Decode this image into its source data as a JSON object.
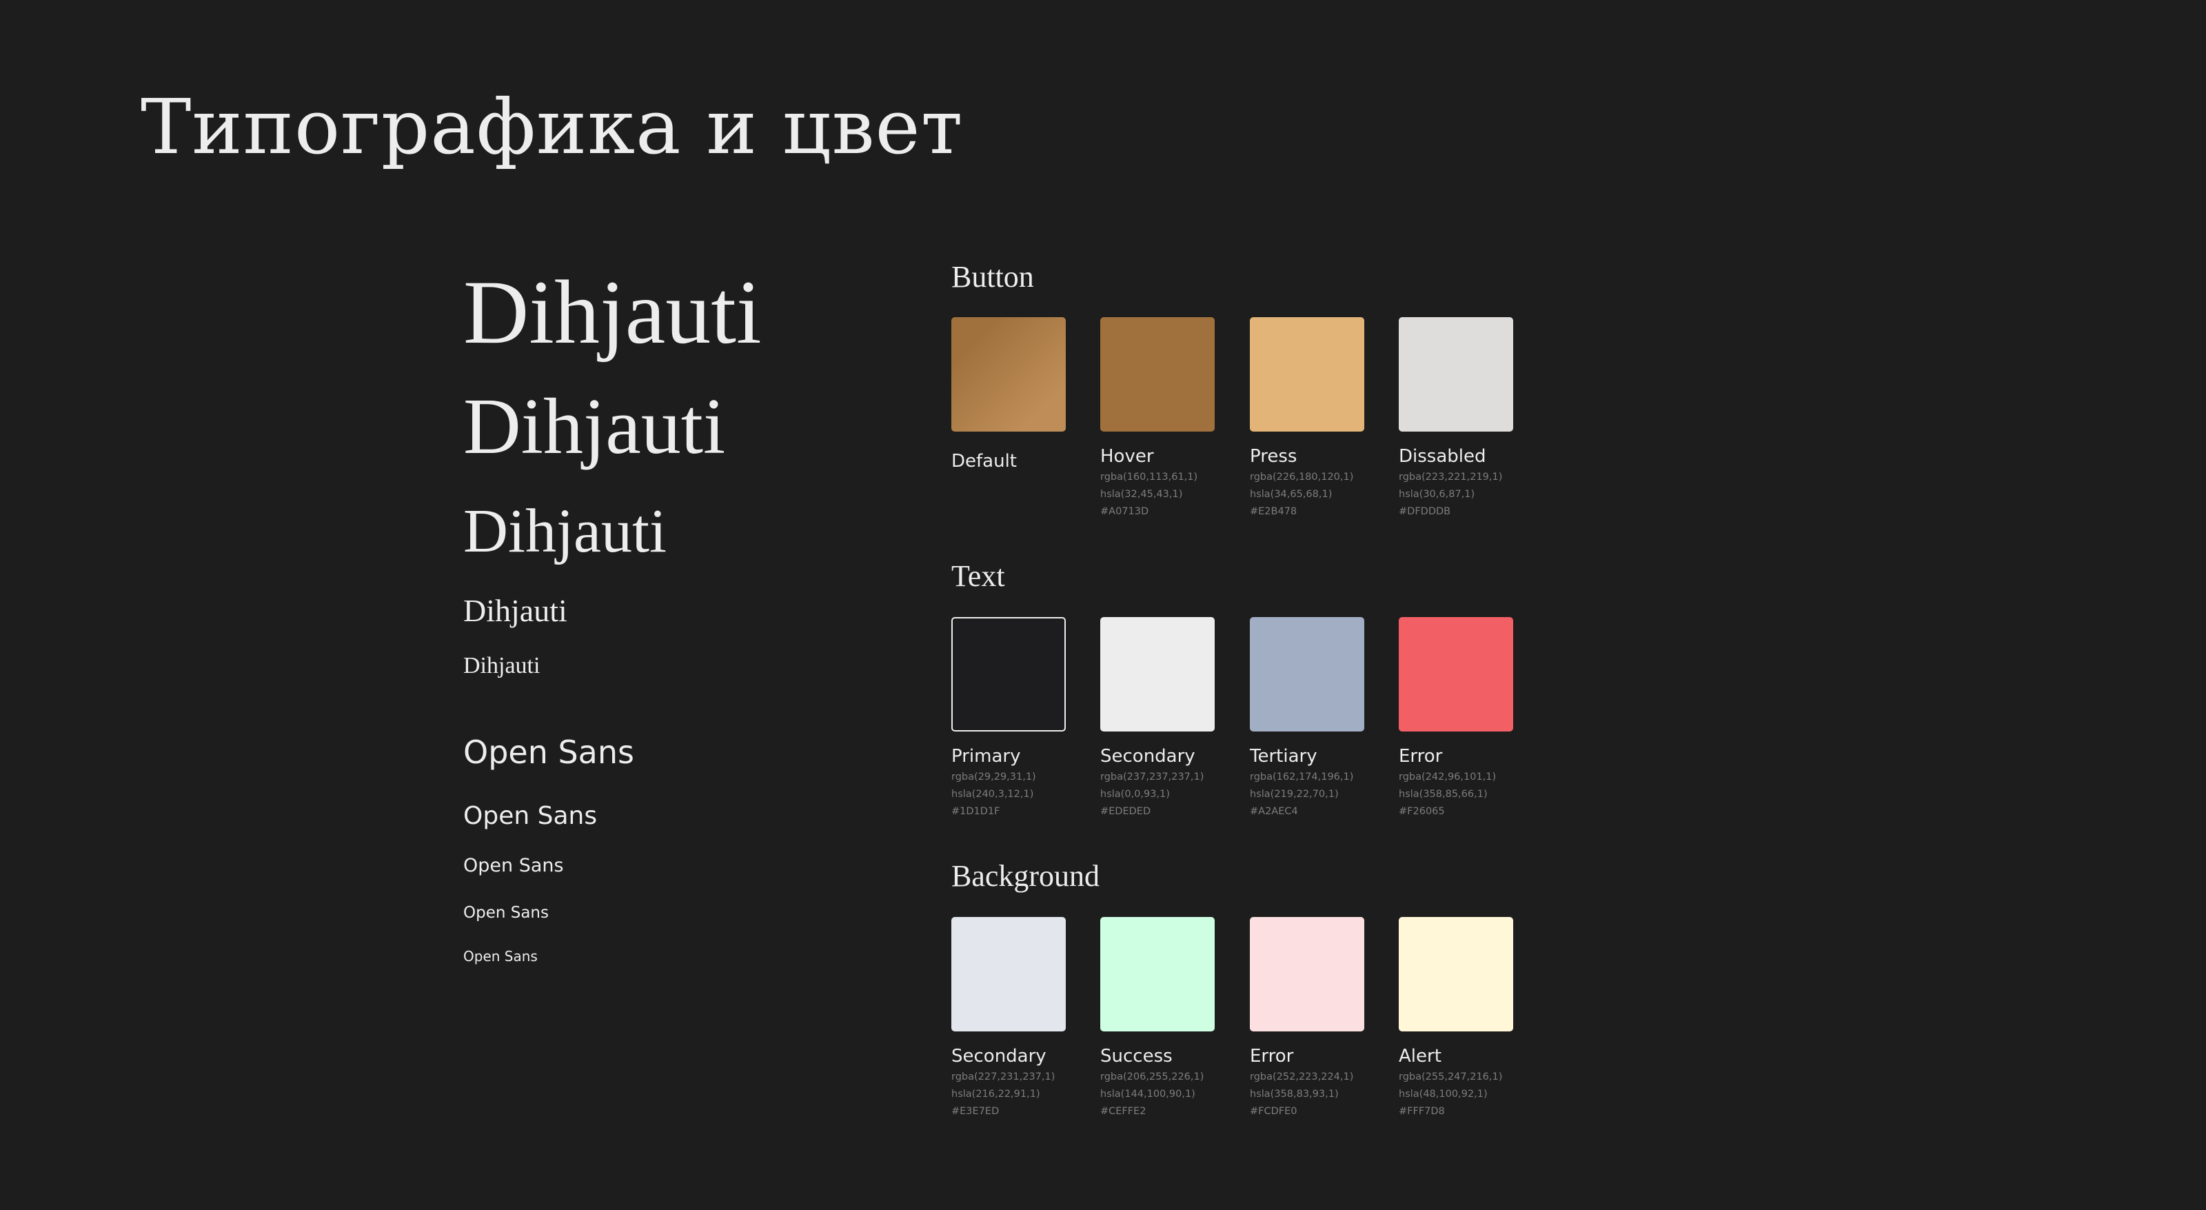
{
  "title": "Типографика и цвет",
  "typography": {
    "serif_samples": [
      "Dihjauti",
      "Dihjauti",
      "Dihjauti",
      "Dihjauti",
      "Dihjauti"
    ],
    "sans_samples": [
      "Open Sans",
      "Open Sans",
      "Open Sans",
      "Open Sans",
      "Open Sans"
    ]
  },
  "sections": {
    "button": {
      "title": "Button",
      "items": [
        {
          "name": "Default",
          "color": "#A0713D",
          "gradient_to": "#BF8E58",
          "rgba": "",
          "hsla": "",
          "hex": ""
        },
        {
          "name": "Hover",
          "color": "#A0713D",
          "rgba": "rgba(160,113,61,1)",
          "hsla": "hsla(32,45,43,1)",
          "hex": "#A0713D"
        },
        {
          "name": "Press",
          "color": "#E2B478",
          "rgba": "rgba(226,180,120,1)",
          "hsla": "hsla(34,65,68,1)",
          "hex": "#E2B478"
        },
        {
          "name": "Dissabled",
          "color": "#DFDDDB",
          "rgba": "rgba(223,221,219,1)",
          "hsla": "hsla(30,6,87,1)",
          "hex": "#DFDDDB"
        }
      ]
    },
    "text": {
      "title": "Text",
      "items": [
        {
          "name": "Primary",
          "color": "#1D1D1F",
          "border": "#EDEDED",
          "rgba": "rgba(29,29,31,1)",
          "hsla": "hsla(240,3,12,1)",
          "hex": "#1D1D1F"
        },
        {
          "name": "Secondary",
          "color": "#EDEDED",
          "rgba": "rgba(237,237,237,1)",
          "hsla": "hsla(0,0,93,1)",
          "hex": "#EDEDED"
        },
        {
          "name": "Tertiary",
          "color": "#A2AEC4",
          "rgba": "rgba(162,174,196,1)",
          "hsla": "hsla(219,22,70,1)",
          "hex": "#A2AEC4"
        },
        {
          "name": "Error",
          "color": "#F26065",
          "rgba": "rgba(242,96,101,1)",
          "hsla": "hsla(358,85,66,1)",
          "hex": "#F26065"
        }
      ]
    },
    "background": {
      "title": "Background",
      "items": [
        {
          "name": "Secondary",
          "color": "#E3E7ED",
          "rgba": "rgba(227,231,237,1)",
          "hsla": "hsla(216,22,91,1)",
          "hex": "#E3E7ED"
        },
        {
          "name": "Success",
          "color": "#CEFFE2",
          "rgba": "rgba(206,255,226,1)",
          "hsla": "hsla(144,100,90,1)",
          "hex": "#CEFFE2"
        },
        {
          "name": "Error",
          "color": "#FCDFE0",
          "rgba": "rgba(252,223,224,1)",
          "hsla": "hsla(358,83,93,1)",
          "hex": "#FCDFE0"
        },
        {
          "name": "Alert",
          "color": "#FFF7D8",
          "rgba": "rgba(255,247,216,1)",
          "hsla": "hsla(48,100,92,1)",
          "hex": "#FFF7D8"
        }
      ]
    }
  }
}
